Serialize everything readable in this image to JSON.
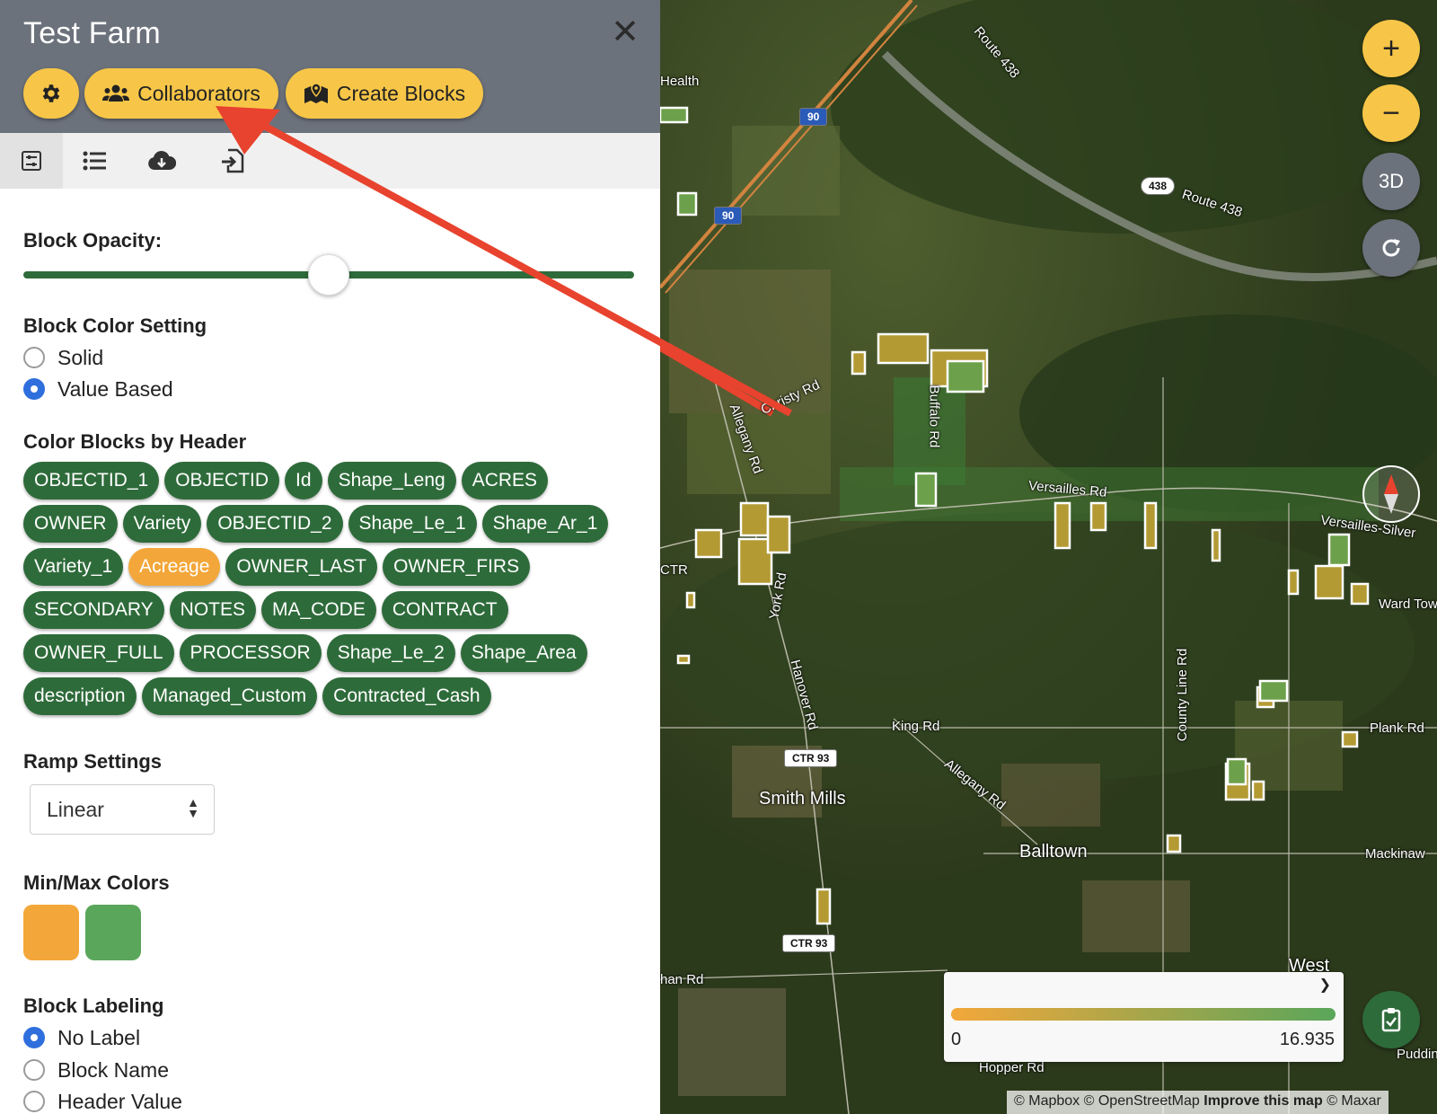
{
  "panel": {
    "title": "Test Farm",
    "close_label": "✕",
    "buttons": {
      "collaborators": "Collaborators",
      "create_blocks": "Create Blocks"
    },
    "tabs": [
      "settings-panel-tab",
      "list-tab",
      "cloud-download-tab",
      "import-tab"
    ],
    "block_opacity": {
      "label": "Block Opacity:",
      "value": 0.5
    },
    "color_setting": {
      "label": "Block Color Setting",
      "options": [
        "Solid",
        "Value Based"
      ],
      "selected": "Value Based"
    },
    "color_by_header": {
      "label": "Color Blocks by Header",
      "headers": [
        "OBJECTID_1",
        "OBJECTID",
        "Id",
        "Shape_Leng",
        "ACRES",
        "OWNER",
        "Variety",
        "OBJECTID_2",
        "Shape_Le_1",
        "Shape_Ar_1",
        "Variety_1",
        "Acreage",
        "OWNER_LAST",
        "OWNER_FIRS",
        "SECONDARY",
        "NOTES",
        "MA_CODE",
        "CONTRACT",
        "OWNER_FULL",
        "PROCESSOR",
        "Shape_Le_2",
        "Shape_Area",
        "description",
        "Managed_Custom",
        "Contracted_Cash"
      ],
      "selected": "Acreage"
    },
    "ramp": {
      "label": "Ramp Settings",
      "value": "Linear"
    },
    "minmax": {
      "label": "Min/Max Colors",
      "min_color": "#f3a73a",
      "max_color": "#5aa65a"
    },
    "labeling": {
      "label": "Block Labeling",
      "options": [
        "No Label",
        "Block Name",
        "Header Value"
      ],
      "selected": "No Label"
    }
  },
  "map": {
    "labels": {
      "route438a": "Route 438",
      "route438b": "Route 438",
      "shield438": "438",
      "shield90a": "90",
      "shield90b": "90",
      "christy": "Christy Rd",
      "allegany": "Allegany Rd",
      "buffalo": "Buffalo Rd",
      "versailles": "Versailles Rd",
      "versailles_silver": "Versailles-Silver",
      "york": "York Rd",
      "hanover": "Hanover Rd",
      "king": "King Rd",
      "allegany2": "Allegany Rd",
      "county_line": "County Line Rd",
      "plank": "Plank Rd",
      "ctr93a": "CTR 93",
      "ctr93b": "CTR 93",
      "smith_mills": "Smith Mills",
      "balltown": "Balltown",
      "mackinaw": "Mackinaw",
      "west": "West",
      "hopper": "Hopper Rd",
      "health": "Health",
      "ctr_left": "CTR",
      "ward_town": "Ward Tow",
      "pudding": "Puddin",
      "han_rd": "han Rd"
    },
    "controls": {
      "zoom_in": "+",
      "zoom_out": "−",
      "three_d": "3D"
    },
    "legend": {
      "min": "0",
      "max": "16.935"
    },
    "attribution": {
      "mapbox": "© Mapbox",
      "osm": "© OpenStreetMap",
      "improve": "Improve this map",
      "maxar": "© Maxar"
    }
  }
}
